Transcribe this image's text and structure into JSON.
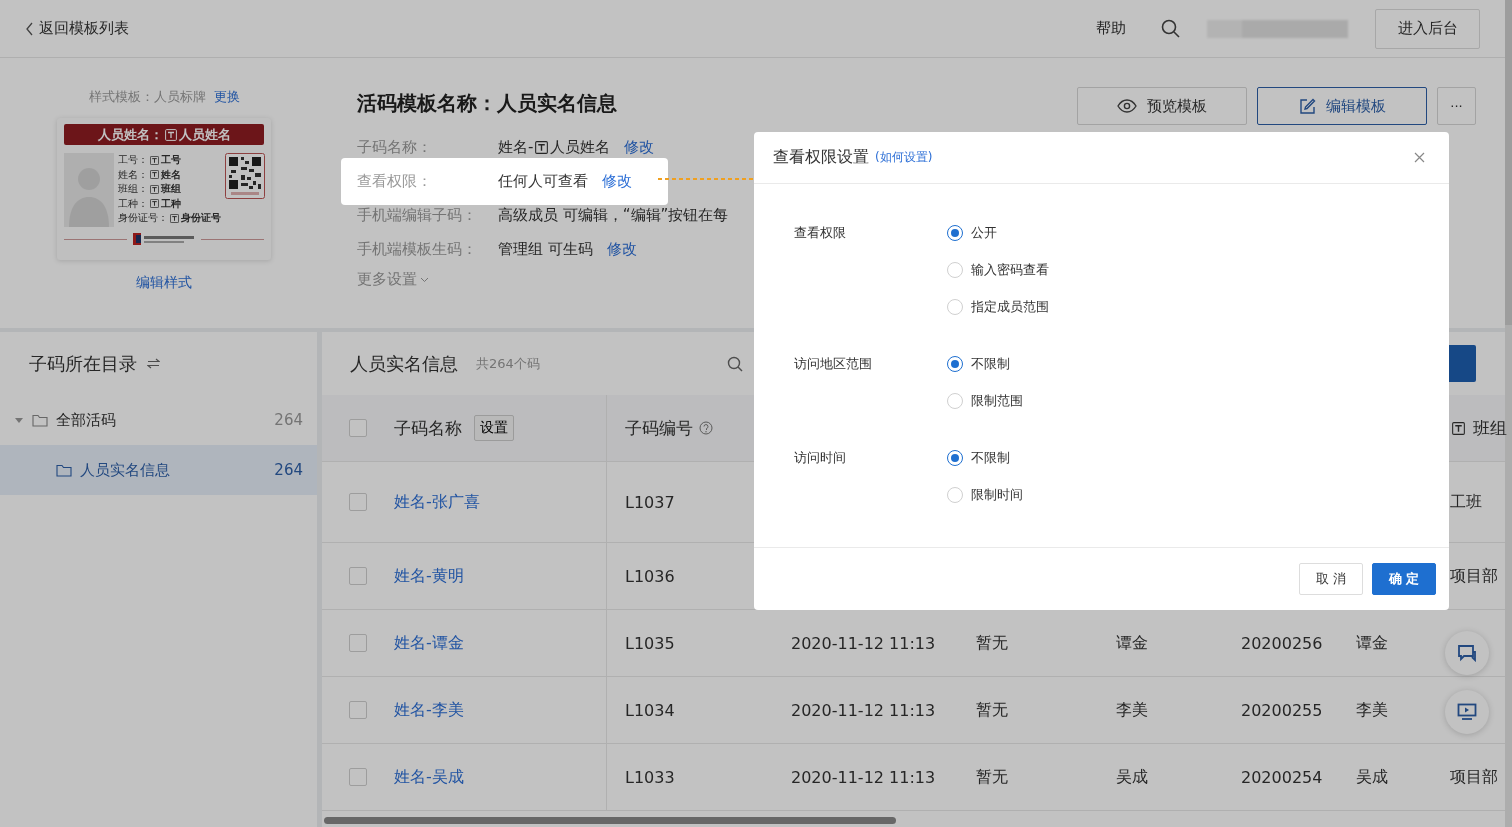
{
  "topbar": {
    "back_link": "返回模板列表",
    "help_link": "帮助",
    "admin_button": "进入后台"
  },
  "template_style": {
    "label": "样式模板：",
    "name": "人员标牌",
    "change_link": "更换",
    "edit_link": "编辑样式"
  },
  "badge": {
    "title_prefix": "人员姓名：",
    "title_field": "人员姓名",
    "fields": [
      {
        "label": "工号：",
        "value": "工号"
      },
      {
        "label": "姓名：",
        "value": "姓名"
      },
      {
        "label": "班组：",
        "value": "班组"
      },
      {
        "label": "工种：",
        "value": "工种"
      },
      {
        "label": "身份证号：",
        "value": "身份证号"
      }
    ]
  },
  "template": {
    "title": "活码模板名称：人员实名信息",
    "more_settings": "更多设置",
    "buttons": [
      {
        "kind": "preview",
        "label": "预览模板"
      },
      {
        "kind": "edit",
        "label": "编辑模板"
      },
      {
        "kind": "more",
        "label": "···"
      }
    ]
  },
  "info_rows": [
    {
      "label": "子码名称：",
      "value": "姓名-",
      "field_value": "人员姓名",
      "link": "修改",
      "highlighted": false
    },
    {
      "label": "查看权限：",
      "value": "任何人可查看",
      "link": "修改",
      "highlighted": true
    },
    {
      "label": "手机端编辑子码：",
      "value": "高级成员 可编辑，“编辑”按钮在每",
      "highlighted": false
    },
    {
      "label": "手机端模板生码：",
      "value": "管理组 可生码",
      "link": "修改",
      "highlighted": false
    }
  ],
  "sidebar": {
    "title": "子码所在目录",
    "tree": [
      {
        "label": "全部活码",
        "count": "264",
        "expanded": true,
        "selected": false,
        "children": [
          {
            "label": "人员实名信息",
            "count": "264",
            "selected": true
          }
        ]
      }
    ]
  },
  "table": {
    "title": "人员实名信息",
    "count": "共264个码",
    "header_checked": false,
    "columns": [
      {
        "label": "子码名称",
        "button": "设置"
      },
      {
        "label": "子码编号",
        "help": true
      },
      {
        "label": "班组",
        "field_icon": true
      }
    ],
    "rows": [
      {
        "checked": false,
        "name": "姓名-张广喜",
        "code": "L1037",
        "column_8": "工班"
      },
      {
        "checked": false,
        "name": "姓名-黄明",
        "code": "L1036",
        "column_8": "项目部"
      },
      {
        "checked": false,
        "name": "姓名-谭金",
        "code": "L1035",
        "column_3": "2020-11-12 11:13",
        "column_4": "暂无",
        "column_5": "谭金",
        "column_6": "20200256",
        "column_7": "谭金"
      },
      {
        "checked": false,
        "name": "姓名-李美",
        "code": "L1034",
        "column_3": "2020-11-12 11:13",
        "column_4": "暂无",
        "column_5": "李美",
        "column_6": "20200255",
        "column_7": "李美"
      },
      {
        "checked": false,
        "name": "姓名-吴成",
        "code": "L1033",
        "column_3": "2020-11-12 11:13",
        "column_4": "暂无",
        "column_5": "吴成",
        "column_6": "20200254",
        "column_7": "吴成",
        "column_8": "项目部"
      }
    ]
  },
  "dialog": {
    "title": "查看权限设置",
    "help_link": "(如何设置)",
    "sections": [
      {
        "label": "查看权限",
        "options": [
          {
            "label": "公开",
            "selected": true
          },
          {
            "label": "输入密码查看",
            "selected": false
          },
          {
            "label": "指定成员范围",
            "selected": false
          }
        ]
      },
      {
        "label": "访问地区范围",
        "options": [
          {
            "label": "不限制",
            "selected": true
          },
          {
            "label": "限制范围",
            "selected": false
          }
        ]
      },
      {
        "label": "访问时间",
        "options": [
          {
            "label": "不限制",
            "selected": true
          },
          {
            "label": "限制时间",
            "selected": false
          }
        ]
      }
    ],
    "cancel_button": "取 消",
    "ok_button": "确 定"
  }
}
